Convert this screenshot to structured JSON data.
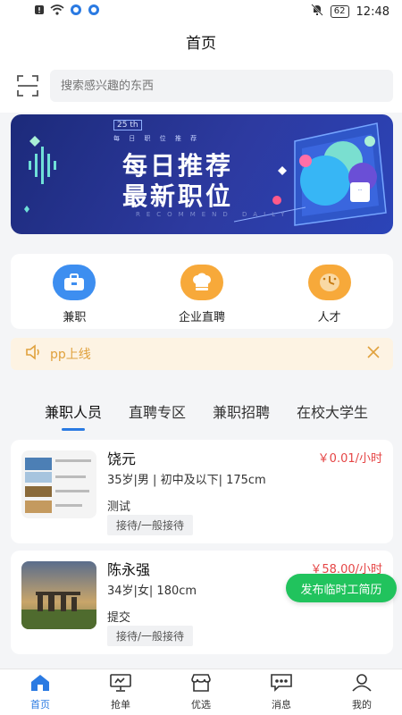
{
  "status_bar": {
    "time": "12:48",
    "battery": "62"
  },
  "header": {
    "title": "首页"
  },
  "search": {
    "placeholder": "搜索感兴趣的东西"
  },
  "banner": {
    "badge": "25 th",
    "sub": "每 日 职 位 推 荐",
    "line1": "每日推荐",
    "line2": "最新职位",
    "english": "RECOMMEND DAILY"
  },
  "quick": [
    {
      "label": "兼职",
      "icon": "briefcase-icon",
      "color": "#3d8ef0"
    },
    {
      "label": "企业直聘",
      "icon": "chef-hat-icon",
      "color": "#f7a93a"
    },
    {
      "label": "人才",
      "icon": "clock-icon",
      "color": "#f7a93a"
    }
  ],
  "notice": {
    "text": "pp上线"
  },
  "tabs": [
    "兼职人员",
    "直聘专区",
    "兼职招聘",
    "在校大学生"
  ],
  "cards": [
    {
      "name": "饶元",
      "price": "￥0.01/小时",
      "meta": "35岁|男 | 初中及以下| 175cm",
      "desc": "测试",
      "tag": "接待/一般接待"
    },
    {
      "name": "陈永强",
      "price": "￥58.00/小时",
      "meta": "34岁|女| 180cm",
      "desc": "提交",
      "tag": "接待/一般接待"
    }
  ],
  "fab": {
    "label": "发布临时工简历"
  },
  "tabbar": [
    {
      "label": "首页",
      "icon": "home-icon"
    },
    {
      "label": "抢单",
      "icon": "monitor-icon"
    },
    {
      "label": "优选",
      "icon": "store-icon"
    },
    {
      "label": "消息",
      "icon": "message-icon"
    },
    {
      "label": "我的",
      "icon": "user-icon"
    }
  ],
  "colors": {
    "accent": "#2a7ae2",
    "price": "#e54545",
    "fab": "#21c35d",
    "notice": "#e0a13c"
  }
}
